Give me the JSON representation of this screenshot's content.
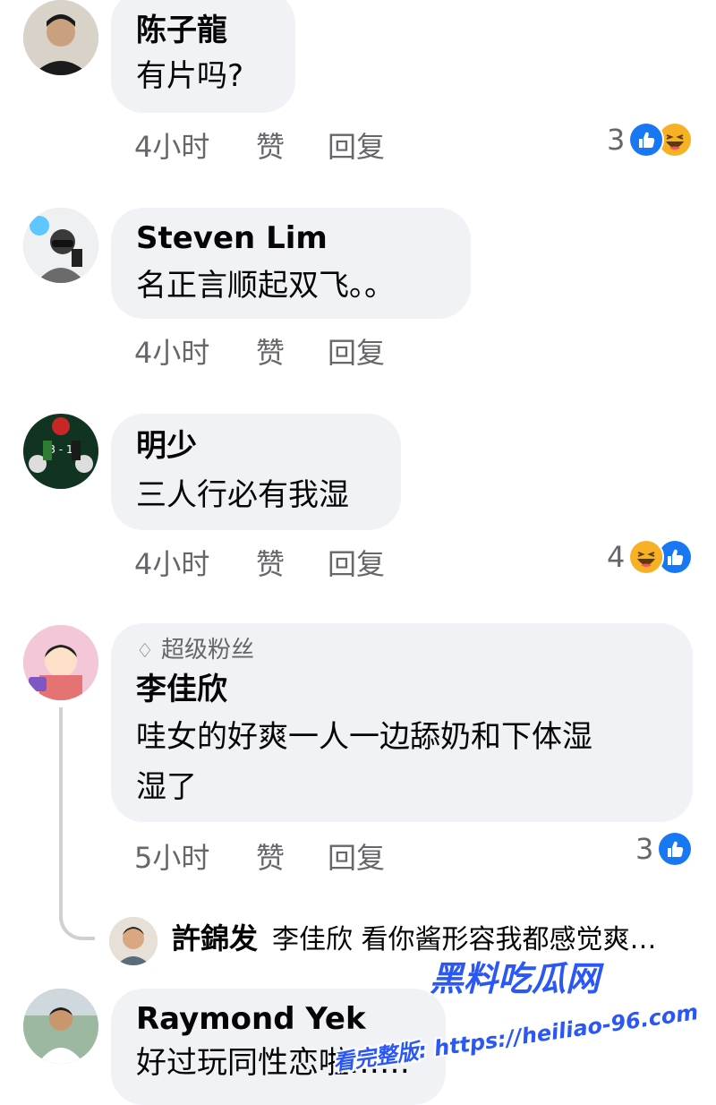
{
  "comments": [
    {
      "name": "陈子龍",
      "text": [
        "有片吗?"
      ],
      "time": "4小时",
      "like": "赞",
      "reply": "回复",
      "reactions": {
        "count": "3",
        "icons": [
          "like-icon",
          "haha-icon"
        ]
      }
    },
    {
      "name": "Steven Lim",
      "text": [
        "名正言顺起双飞。。"
      ],
      "time": "4小时",
      "like": "赞",
      "reply": "回复"
    },
    {
      "name": "明少",
      "text": [
        "三人行必有我湿"
      ],
      "time": "4小时",
      "like": "赞",
      "reply": "回复",
      "reactions": {
        "count": "4",
        "icons": [
          "haha-icon",
          "like-icon"
        ]
      }
    },
    {
      "badge": "超级粉丝",
      "name": "李佳欣",
      "text": [
        "哇女的好爽一人一边舔奶和下体湿",
        "湿了"
      ],
      "time": "5小时",
      "like": "赞",
      "reply": "回复",
      "reactions": {
        "count": "3",
        "icons": [
          "like-icon"
        ]
      }
    },
    {
      "name": "Raymond Yek",
      "text": [
        "好过玩同性恋啦……"
      ]
    }
  ],
  "reply_preview": {
    "name": "許錦发",
    "text": "李佳欣 看你酱形容我都感觉爽…"
  },
  "watermark": {
    "title": "黑料吃瓜网",
    "url": "看完整版: https://heiliao-96.com"
  },
  "colors": {
    "bubble": "#f0f2f5",
    "like_blue": "#1877f2",
    "haha_yellow": "#f7b125",
    "meta_gray": "#65676b"
  }
}
